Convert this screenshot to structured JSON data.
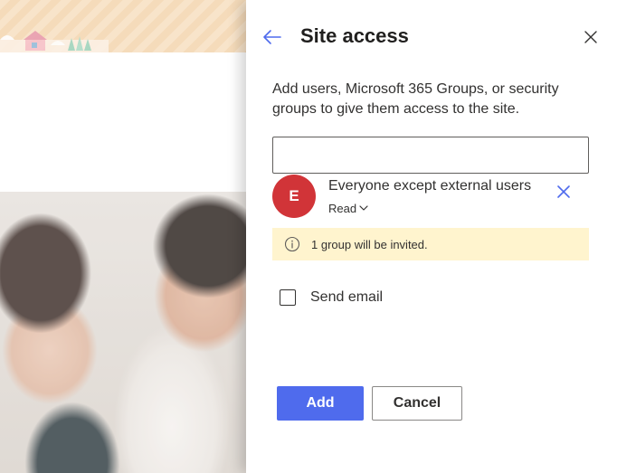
{
  "panel": {
    "title": "Site access",
    "back_icon": "arrow-left-icon",
    "close_icon": "close-icon",
    "description": "Add users, Microsoft 365 Groups, or security groups to give them access to the site.",
    "search": {
      "value": "",
      "placeholder": ""
    },
    "members": [
      {
        "initial": "E",
        "name": "Everyone except external users",
        "permission": "Read",
        "avatar_color": "#d13438",
        "remove_icon": "close-icon"
      }
    ],
    "notice": {
      "icon": "info-icon",
      "text": "1 group will be invited.",
      "background": "#fff4ce"
    },
    "send_email": {
      "label": "Send email",
      "checked": false
    },
    "buttons": {
      "add": "Add",
      "cancel": "Cancel"
    }
  },
  "colors": {
    "primary": "#4f6bed",
    "text": "#323130",
    "accent_icon": "#4f6bed"
  }
}
